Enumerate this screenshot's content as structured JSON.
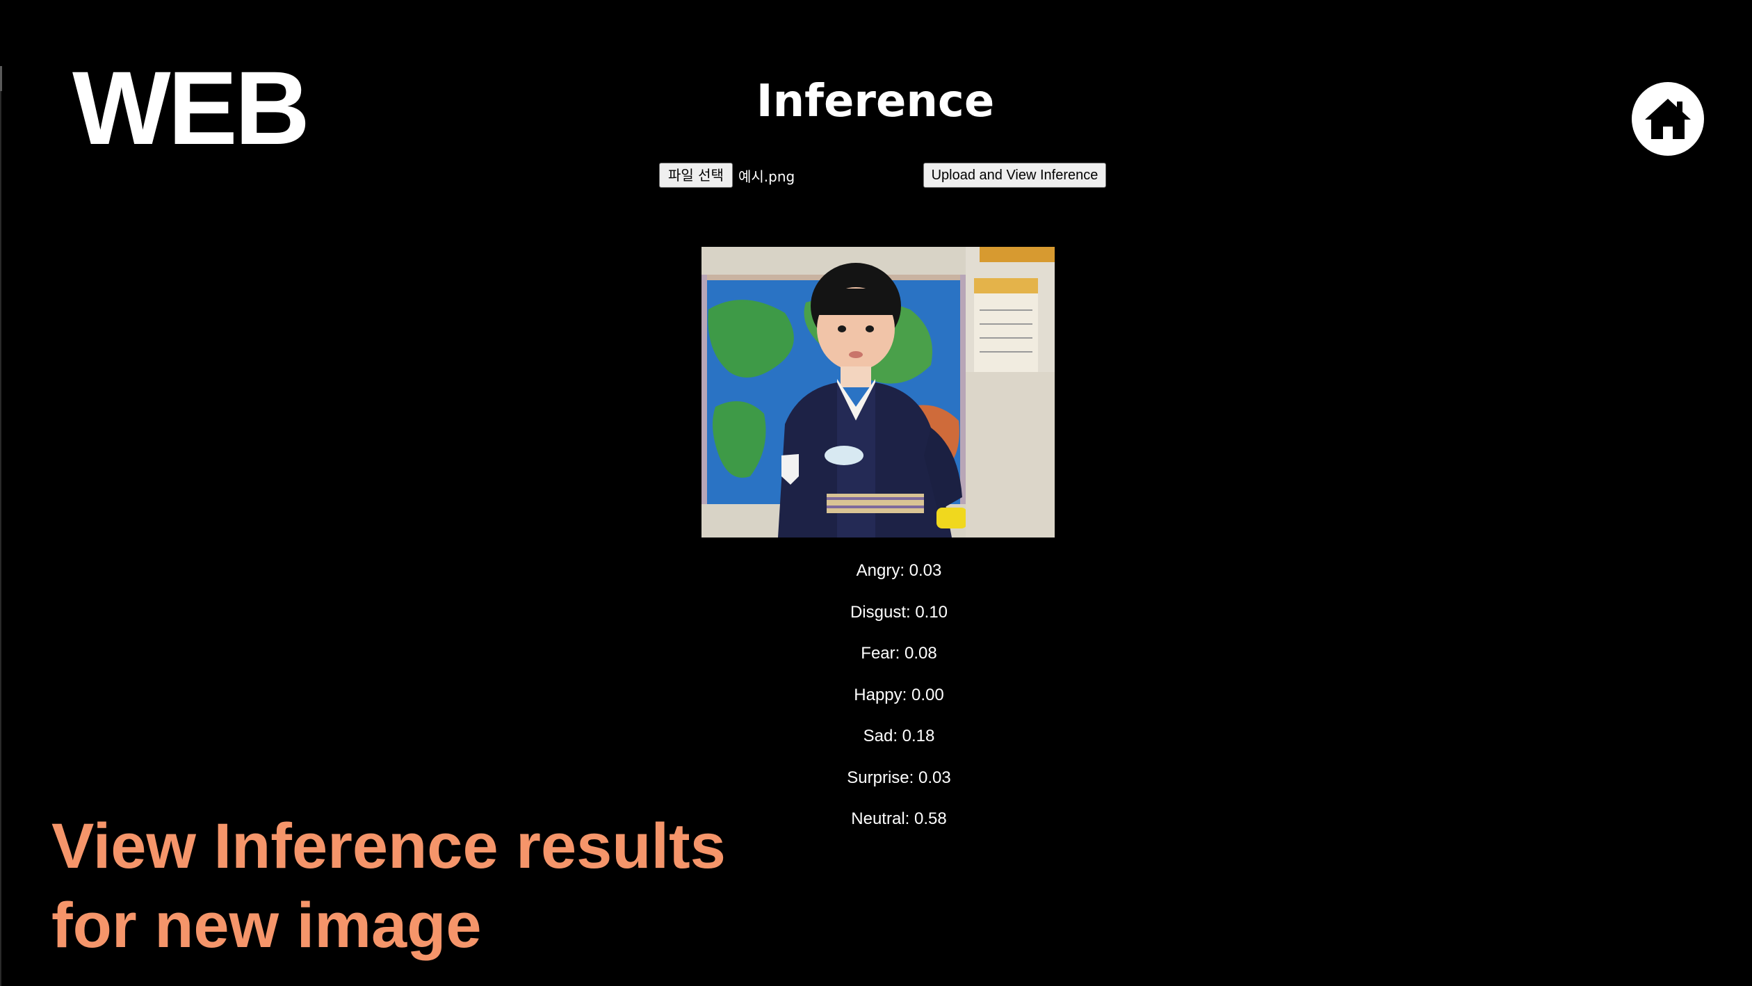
{
  "brand": {
    "label": "WEB"
  },
  "header": {
    "title": "Inference"
  },
  "home": {
    "icon": "home-icon"
  },
  "upload": {
    "choose_file_label": "파일 선택",
    "file_name": "예시.png",
    "submit_label": "Upload and View Inference"
  },
  "image": {
    "subject": "child-photo"
  },
  "results": {
    "items": [
      "Angry: 0.03",
      "Disgust: 0.10",
      "Fear: 0.08",
      "Happy: 0.00",
      "Sad: 0.18",
      "Surprise: 0.03",
      "Neutral: 0.58"
    ]
  },
  "caption": {
    "line1": "View Inference results",
    "line2": "for new image"
  },
  "colors": {
    "background": "#000000",
    "text": "#ffffff",
    "caption": "#f5956a"
  }
}
